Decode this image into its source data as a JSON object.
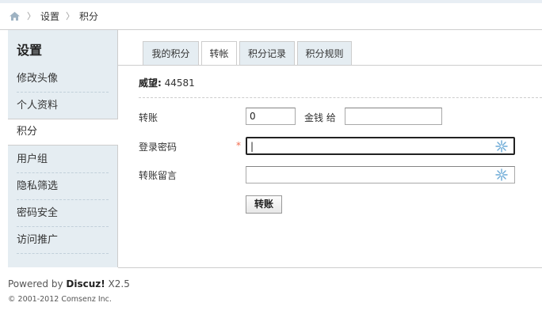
{
  "breadcrumb": {
    "home_icon": "home-icon",
    "items": [
      "设置",
      "积分"
    ],
    "separator": "〉"
  },
  "sidebar": {
    "title": "设置",
    "items": [
      {
        "label": "修改头像"
      },
      {
        "label": "个人资料"
      },
      {
        "label": "积分",
        "active": true
      },
      {
        "label": "用户组"
      },
      {
        "label": "隐私筛选"
      },
      {
        "label": "密码安全"
      },
      {
        "label": "访问推广"
      }
    ]
  },
  "tabs": [
    {
      "label": "我的积分"
    },
    {
      "label": "转帐",
      "active": true
    },
    {
      "label": "积分记录"
    },
    {
      "label": "积分规则"
    }
  ],
  "weiwang": {
    "label": "威望:",
    "value": "44581"
  },
  "form": {
    "transfer_label": "转账",
    "amount_value": "0",
    "currency_text": "金钱 给",
    "recipient_value": "",
    "password_label": "登录密码",
    "required_mark": "*",
    "password_value": "|",
    "message_label": "转账留言",
    "message_value": "",
    "submit_label": "转账"
  },
  "footer": {
    "powered_prefix": "Powered by ",
    "product": "Discuz!",
    "version": " X2.5",
    "copyright": "© 2001-2012 Comsenz Inc."
  },
  "colors": {
    "sidebar_bg": "#e5edf2",
    "border": "#cdcdcd",
    "required": "#f26c4f"
  }
}
